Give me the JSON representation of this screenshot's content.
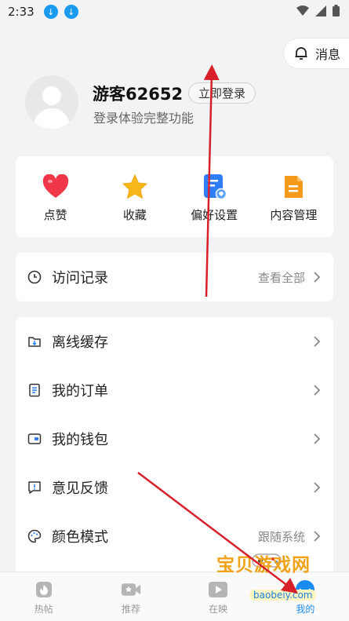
{
  "status_bar": {
    "time": "2:33"
  },
  "header": {
    "message_label": "消息"
  },
  "profile": {
    "username": "游客62652",
    "login_label": "立即登录",
    "subtitle": "登录体验完整功能"
  },
  "quick_actions": [
    {
      "label": "点赞",
      "icon": "heart-icon",
      "color": "#f0374a"
    },
    {
      "label": "收藏",
      "icon": "star-icon",
      "color": "#f7b81c"
    },
    {
      "label": "偏好设置",
      "icon": "preference-icon",
      "color": "#2f7ef5"
    },
    {
      "label": "内容管理",
      "icon": "document-icon",
      "color": "#f79a1c"
    }
  ],
  "visit_history": {
    "label": "访问记录",
    "value": "查看全部"
  },
  "menu": [
    {
      "label": "离线缓存",
      "value": ""
    },
    {
      "label": "我的订单",
      "value": ""
    },
    {
      "label": "我的钱包",
      "value": ""
    },
    {
      "label": "意见反馈",
      "value": ""
    },
    {
      "label": "颜色模式",
      "value": "跟随系统"
    }
  ],
  "bottom_nav": [
    {
      "label": "热帖",
      "active": false
    },
    {
      "label": "推荐",
      "active": false
    },
    {
      "label": "在映",
      "active": false
    },
    {
      "label": "我的",
      "active": true
    }
  ],
  "watermark": {
    "title": "宝贝游戏网",
    "url": "baobeiy.com"
  },
  "colors": {
    "accent": "#1a8cf0",
    "annotation": "#d8202a"
  }
}
